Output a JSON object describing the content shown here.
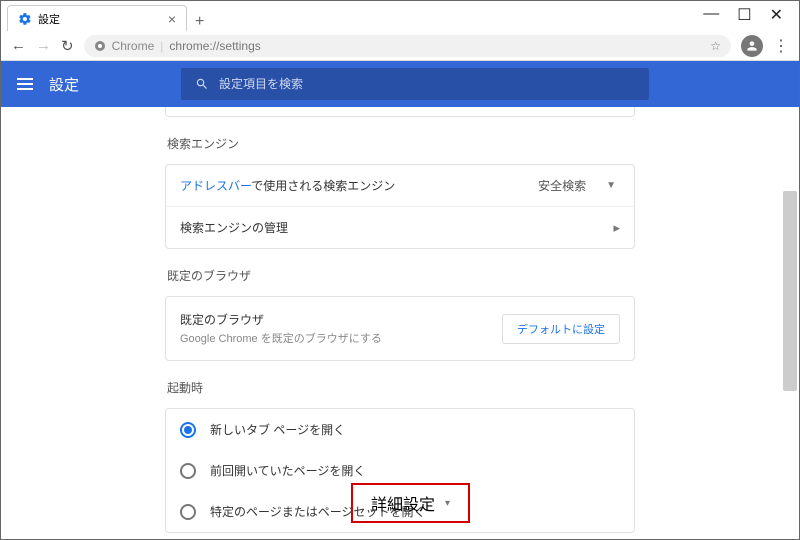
{
  "tab": {
    "title": "設定"
  },
  "addressbar": {
    "chrome_label": "Chrome",
    "url": "chrome://settings"
  },
  "header": {
    "title": "設定",
    "search_placeholder": "設定項目を検索"
  },
  "sections": {
    "search_engine": {
      "heading": "検索エンジン",
      "row1_prefix": "アドレスバー",
      "row1_suffix": "で使用される検索エンジン",
      "selected": "安全検索",
      "row2": "検索エンジンの管理"
    },
    "default_browser": {
      "heading": "既定のブラウザ",
      "title": "既定のブラウザ",
      "subtitle": "Google Chrome を既定のブラウザにする",
      "button": "デフォルトに設定"
    },
    "startup": {
      "heading": "起動時",
      "opt1": "新しいタブ ページを開く",
      "opt2": "前回開いていたページを開く",
      "opt3": "特定のページまたはページセットを開く"
    },
    "advanced": "詳細設定"
  }
}
